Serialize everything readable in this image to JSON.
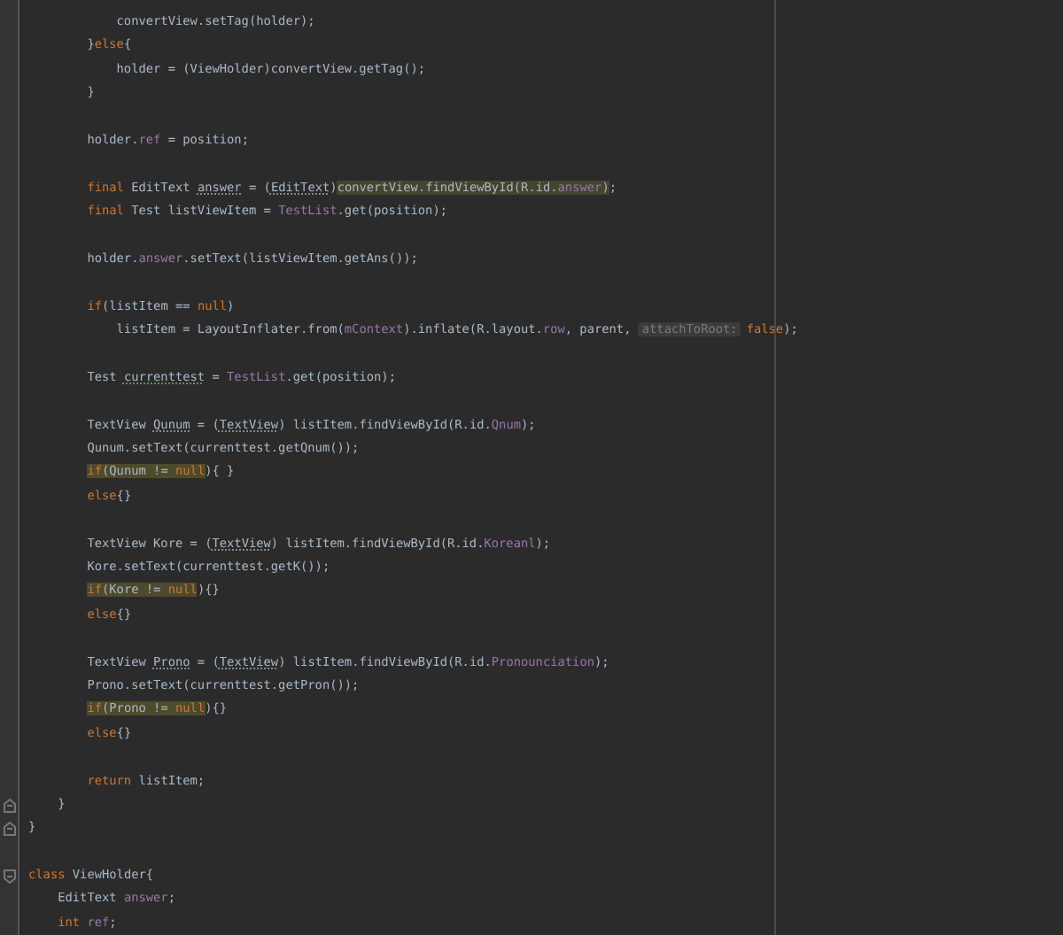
{
  "editor": {
    "lines": [
      {
        "kind": "indent3",
        "tokens": [
          {
            "t": "convertView.setTag(holder);",
            "kind": "plain"
          }
        ]
      },
      {
        "kind": "indent2",
        "tokens": [
          {
            "t": "}",
            "kind": "plain"
          },
          {
            "t": "else",
            "kind": "keyword"
          },
          {
            "t": "{",
            "kind": "plain"
          }
        ]
      },
      {
        "kind": "indent3",
        "tokens": [
          {
            "t": "holder = (ViewHolder)convertView.getTag();",
            "kind": "plain"
          }
        ]
      },
      {
        "kind": "indent2",
        "tokens": [
          {
            "t": "}",
            "kind": "plain"
          }
        ]
      },
      {
        "kind": "blank"
      },
      {
        "kind": "indent2",
        "tokens": [
          {
            "t": "holder.",
            "kind": "plain"
          },
          {
            "t": "ref",
            "kind": "field"
          },
          {
            "t": " = position;",
            "kind": "plain"
          }
        ]
      },
      {
        "kind": "blank"
      },
      {
        "kind": "indent2",
        "tokens": [
          {
            "t": "final",
            "kind": "keyword"
          },
          {
            "t": " EditText ",
            "kind": "plain"
          },
          {
            "t": "answer",
            "kind": "dotted"
          },
          {
            "t": " = (",
            "kind": "plain"
          },
          {
            "t": "EditText",
            "kind": "dotted"
          },
          {
            "t": ")",
            "kind": "plain"
          },
          {
            "t": "convertView.findViewById(R.id.",
            "kind": "match"
          },
          {
            "t": "answer",
            "kind": "matchfield"
          },
          {
            "t": ")",
            "kind": "match"
          },
          {
            "t": ";",
            "kind": "plain"
          }
        ]
      },
      {
        "kind": "indent2",
        "tokens": [
          {
            "t": "final",
            "kind": "keyword"
          },
          {
            "t": " Test listViewItem = ",
            "kind": "plain"
          },
          {
            "t": "TestList",
            "kind": "field"
          },
          {
            "t": ".get(position);",
            "kind": "plain"
          }
        ]
      },
      {
        "kind": "blank"
      },
      {
        "kind": "indent2",
        "tokens": [
          {
            "t": "holder.",
            "kind": "plain"
          },
          {
            "t": "answer",
            "kind": "field"
          },
          {
            "t": ".setText(listViewItem.getAns());",
            "kind": "plain"
          }
        ]
      },
      {
        "kind": "blank"
      },
      {
        "kind": "indent2",
        "tokens": [
          {
            "t": "if",
            "kind": "keyword"
          },
          {
            "t": "(listItem == ",
            "kind": "plain"
          },
          {
            "t": "null",
            "kind": "keyword"
          },
          {
            "t": ")",
            "kind": "plain"
          }
        ]
      },
      {
        "kind": "indent3",
        "tokens": [
          {
            "t": "listItem = LayoutInflater.from(",
            "kind": "plain"
          },
          {
            "t": "mContext",
            "kind": "field"
          },
          {
            "t": ").inflate(R.layout.",
            "kind": "plain"
          },
          {
            "t": "row",
            "kind": "field"
          },
          {
            "t": ", parent, ",
            "kind": "plain"
          },
          {
            "t": "attachToRoot:",
            "kind": "hint"
          },
          {
            "t": "false",
            "kind": "keyword"
          },
          {
            "t": ");",
            "kind": "plain"
          }
        ]
      },
      {
        "kind": "blank"
      },
      {
        "kind": "indent2",
        "tokens": [
          {
            "t": "Test ",
            "kind": "plain"
          },
          {
            "t": "currenttest",
            "kind": "typo"
          },
          {
            "t": " = ",
            "kind": "plain"
          },
          {
            "t": "TestList",
            "kind": "field"
          },
          {
            "t": ".get(position);",
            "kind": "plain"
          }
        ]
      },
      {
        "kind": "blank"
      },
      {
        "kind": "indent2",
        "tokens": [
          {
            "t": "TextView ",
            "kind": "plain"
          },
          {
            "t": "Qunum",
            "kind": "dotted"
          },
          {
            "t": " = (",
            "kind": "plain"
          },
          {
            "t": "TextView",
            "kind": "dotted"
          },
          {
            "t": ") listItem.findViewById(R.id.",
            "kind": "plain"
          },
          {
            "t": "Qnum",
            "kind": "field"
          },
          {
            "t": ");",
            "kind": "plain"
          }
        ]
      },
      {
        "kind": "indent2",
        "tokens": [
          {
            "t": "Qunum.setText(currenttest.getQnum());",
            "kind": "plain"
          }
        ]
      },
      {
        "kind": "indent2",
        "tokens": [
          {
            "t": "if",
            "kind": "warnkw"
          },
          {
            "t": "(Qunum != ",
            "kind": "warn"
          },
          {
            "t": "null",
            "kind": "warnkw"
          },
          {
            "t": "){ }",
            "kind": "plain"
          }
        ]
      },
      {
        "kind": "indent2",
        "tokens": [
          {
            "t": "else",
            "kind": "keyword"
          },
          {
            "t": "{}",
            "kind": "plain"
          }
        ]
      },
      {
        "kind": "blank"
      },
      {
        "kind": "indent2",
        "tokens": [
          {
            "t": "TextView Kore = (",
            "kind": "plain"
          },
          {
            "t": "TextView",
            "kind": "dotted"
          },
          {
            "t": ") listItem.findViewById(R.id.",
            "kind": "plain"
          },
          {
            "t": "Koreanl",
            "kind": "field"
          },
          {
            "t": ");",
            "kind": "plain"
          }
        ]
      },
      {
        "kind": "indent2",
        "tokens": [
          {
            "t": "Kore.setText(currenttest.getK());",
            "kind": "plain"
          }
        ]
      },
      {
        "kind": "indent2",
        "tokens": [
          {
            "t": "if",
            "kind": "warnkw"
          },
          {
            "t": "(Kore != ",
            "kind": "warn"
          },
          {
            "t": "null",
            "kind": "warnkw"
          },
          {
            "t": "){}",
            "kind": "plain"
          }
        ]
      },
      {
        "kind": "indent2",
        "tokens": [
          {
            "t": "else",
            "kind": "keyword"
          },
          {
            "t": "{}",
            "kind": "plain"
          }
        ]
      },
      {
        "kind": "blank"
      },
      {
        "kind": "indent2",
        "tokens": [
          {
            "t": "TextView ",
            "kind": "plain"
          },
          {
            "t": "Prono",
            "kind": "dotted"
          },
          {
            "t": " = (",
            "kind": "plain"
          },
          {
            "t": "TextView",
            "kind": "dotted"
          },
          {
            "t": ") listItem.findViewById(R.id.",
            "kind": "plain"
          },
          {
            "t": "Pronounciation",
            "kind": "field"
          },
          {
            "t": ");",
            "kind": "plain"
          }
        ]
      },
      {
        "kind": "indent2",
        "tokens": [
          {
            "t": "Prono.setText(currenttest.getPron());",
            "kind": "plain"
          }
        ]
      },
      {
        "kind": "indent2",
        "tokens": [
          {
            "t": "if",
            "kind": "warnkw"
          },
          {
            "t": "(Prono != ",
            "kind": "warn"
          },
          {
            "t": "null",
            "kind": "warnkw"
          },
          {
            "t": "){}",
            "kind": "plain"
          }
        ]
      },
      {
        "kind": "indent2",
        "tokens": [
          {
            "t": "else",
            "kind": "keyword"
          },
          {
            "t": "{}",
            "kind": "plain"
          }
        ]
      },
      {
        "kind": "blank"
      },
      {
        "kind": "indent2",
        "tokens": [
          {
            "t": "return",
            "kind": "keyword"
          },
          {
            "t": " listItem;",
            "kind": "plain"
          }
        ]
      },
      {
        "kind": "indent1",
        "tokens": [
          {
            "t": "}",
            "kind": "plain"
          }
        ]
      },
      {
        "kind": "indent0",
        "tokens": [
          {
            "t": "}",
            "kind": "plain"
          }
        ]
      },
      {
        "kind": "blank"
      },
      {
        "kind": "indent0",
        "tokens": [
          {
            "t": "class",
            "kind": "keyword"
          },
          {
            "t": " ViewHolder{",
            "kind": "plain"
          }
        ]
      },
      {
        "kind": "indent1",
        "tokens": [
          {
            "t": "EditText ",
            "kind": "plain"
          },
          {
            "t": "answer",
            "kind": "field"
          },
          {
            "t": ";",
            "kind": "plain"
          }
        ]
      },
      {
        "kind": "indent1",
        "tokens": [
          {
            "t": "int",
            "kind": "keyword"
          },
          {
            "t": " ref",
            "kind": "field"
          },
          {
            "t": ";",
            "kind": "plain"
          }
        ]
      }
    ],
    "gutter": [
      {
        "kind": "empty"
      },
      {
        "kind": "empty"
      },
      {
        "kind": "empty"
      },
      {
        "kind": "empty"
      },
      {
        "kind": "empty"
      },
      {
        "kind": "empty"
      },
      {
        "kind": "empty"
      },
      {
        "kind": "empty"
      },
      {
        "kind": "empty"
      },
      {
        "kind": "empty"
      },
      {
        "kind": "empty"
      },
      {
        "kind": "empty"
      },
      {
        "kind": "empty"
      },
      {
        "kind": "empty"
      },
      {
        "kind": "empty"
      },
      {
        "kind": "empty"
      },
      {
        "kind": "empty"
      },
      {
        "kind": "empty"
      },
      {
        "kind": "empty"
      },
      {
        "kind": "empty"
      },
      {
        "kind": "empty"
      },
      {
        "kind": "empty"
      },
      {
        "kind": "empty"
      },
      {
        "kind": "empty"
      },
      {
        "kind": "empty"
      },
      {
        "kind": "empty"
      },
      {
        "kind": "empty"
      },
      {
        "kind": "empty"
      },
      {
        "kind": "empty"
      },
      {
        "kind": "empty"
      },
      {
        "kind": "empty"
      },
      {
        "kind": "empty"
      },
      {
        "kind": "empty"
      },
      {
        "kind": "foldend"
      },
      {
        "kind": "foldend"
      },
      {
        "kind": "empty"
      },
      {
        "kind": "foldstart"
      },
      {
        "kind": "empty"
      },
      {
        "kind": "empty"
      }
    ]
  }
}
